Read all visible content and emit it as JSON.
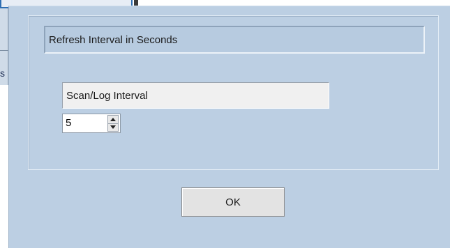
{
  "background_window": {
    "partial_glyph": "s"
  },
  "dialog": {
    "group_title": "Refresh Interval in Seconds",
    "field_label": "Scan/Log Interval",
    "interval_value": "5",
    "ok_label": "OK"
  },
  "icons": {
    "spin_up": "triangle-up-icon",
    "spin_down": "triangle-down-icon"
  },
  "colors": {
    "dialog_bg": "#bccfe3",
    "header_bg": "#b7cbe0",
    "label_bg": "#f0f0f0",
    "button_bg": "#e3e3e3",
    "accent_blue": "#2f6fb3"
  }
}
